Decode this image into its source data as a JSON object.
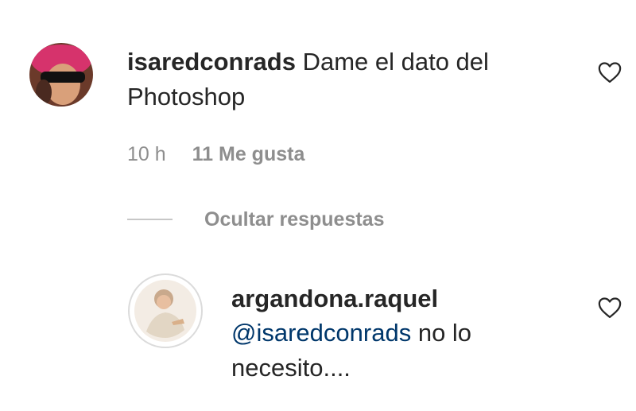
{
  "comment": {
    "username": "isaredconrads",
    "text": "Dame el dato del Photoshop",
    "age": "10 h",
    "likes": "11 Me gusta"
  },
  "replies_toggle": "Ocultar respuestas",
  "reply": {
    "username": "argandona.raquel",
    "mention": "@isaredconrads",
    "text": "no lo necesito...."
  },
  "icons": [
    "avatar",
    "heart-icon"
  ],
  "colors": {
    "text": "#262626",
    "muted": "#8e8e8e",
    "mention": "#00376b",
    "story_ring": "#dbdbdb"
  }
}
